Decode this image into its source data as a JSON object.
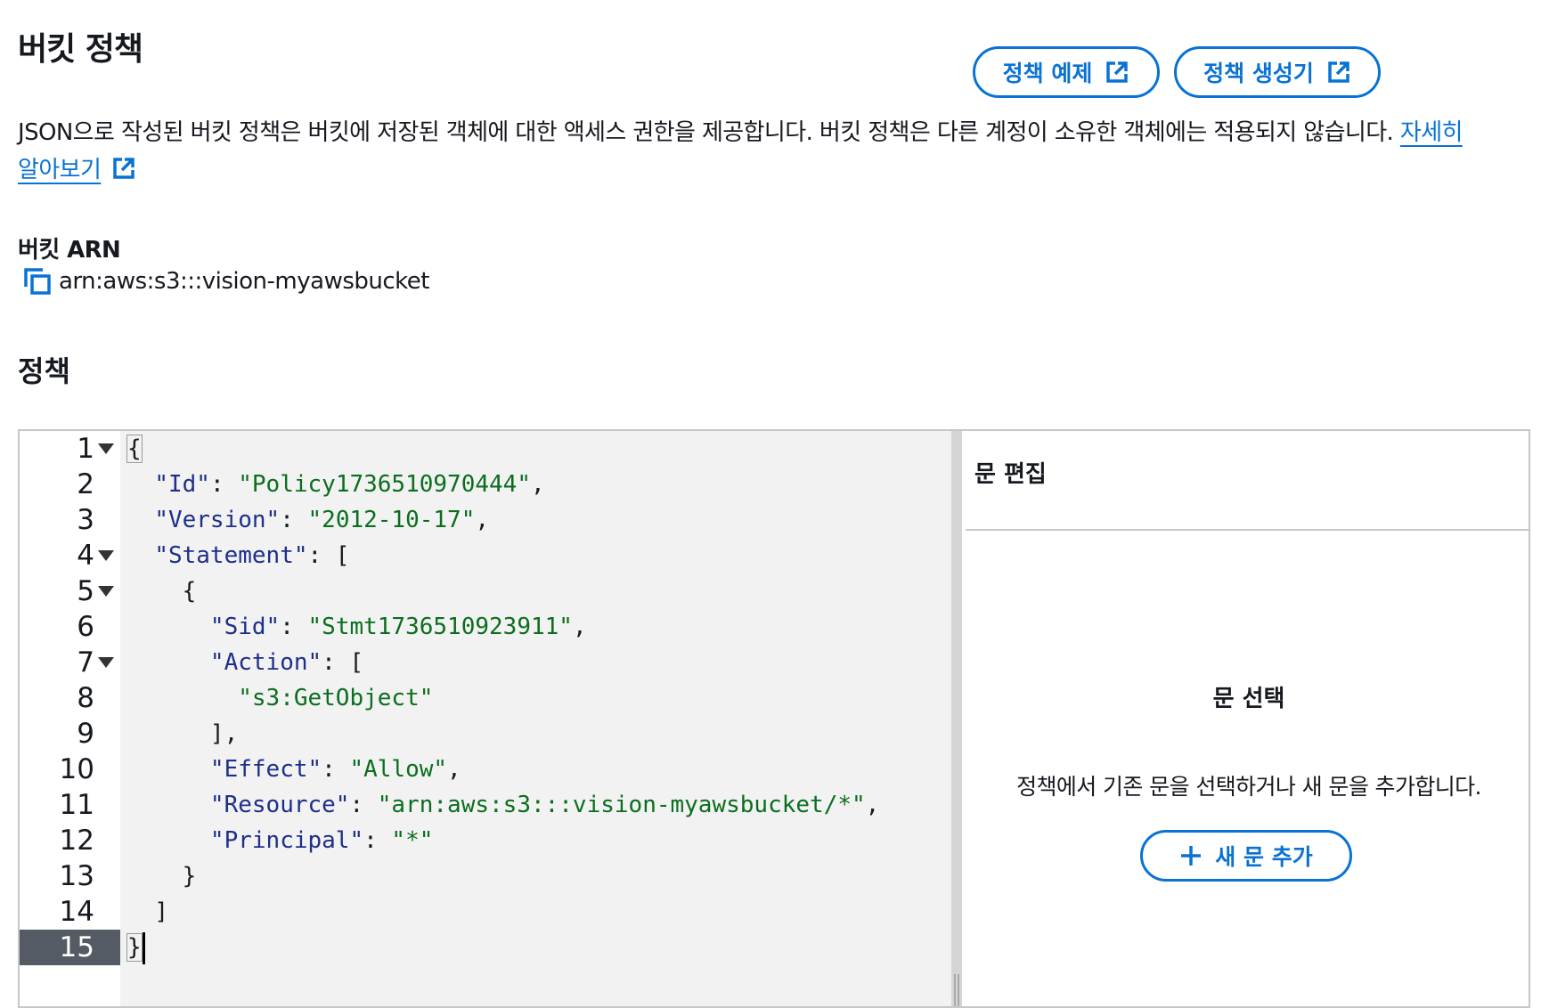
{
  "header": {
    "title": "버킷 정책",
    "policy_examples_label": "정책 예제",
    "policy_generator_label": "정책 생성기"
  },
  "description": {
    "text": "JSON으로 작성된 버킷 정책은 버킷에 저장된 객체에 대한 액세스 권한을 제공합니다. 버킷 정책은 다른 계정이 소유한 객체에는 적용되지 않습니다. ",
    "learn_more_part1": "자세히",
    "learn_more_part2": "알아보기"
  },
  "bucket_arn": {
    "label": "버킷 ARN",
    "value": "arn:aws:s3:::vision-myawsbucket"
  },
  "policy_section": {
    "title": "정책"
  },
  "editor": {
    "lines": [
      {
        "n": "1",
        "fold": true
      },
      {
        "n": "2",
        "fold": false
      },
      {
        "n": "3",
        "fold": false
      },
      {
        "n": "4",
        "fold": true
      },
      {
        "n": "5",
        "fold": true
      },
      {
        "n": "6",
        "fold": false
      },
      {
        "n": "7",
        "fold": true
      },
      {
        "n": "8",
        "fold": false
      },
      {
        "n": "9",
        "fold": false
      },
      {
        "n": "10",
        "fold": false
      },
      {
        "n": "11",
        "fold": false
      },
      {
        "n": "12",
        "fold": false
      },
      {
        "n": "13",
        "fold": false
      },
      {
        "n": "14",
        "fold": false
      },
      {
        "n": "15",
        "fold": false
      }
    ],
    "active_line": "15",
    "code": {
      "l1": "{",
      "id_key": "\"Id\"",
      "id_val": "\"Policy1736510970444\"",
      "version_key": "\"Version\"",
      "version_val": "\"2012-10-17\"",
      "statement_key": "\"Statement\"",
      "l5": "{",
      "sid_key": "\"Sid\"",
      "sid_val": "\"Stmt1736510923911\"",
      "action_key": "\"Action\"",
      "action_val": "\"s3:GetObject\"",
      "l9": "],",
      "effect_key": "\"Effect\"",
      "effect_val": "\"Allow\"",
      "resource_key": "\"Resource\"",
      "resource_val": "\"arn:aws:s3:::vision-myawsbucket/*\"",
      "principal_key": "\"Principal\"",
      "principal_val": "\"*\"",
      "l13": "}",
      "l14": "]",
      "l15": "}"
    }
  },
  "statement_panel": {
    "heading": "문 편집",
    "empty_title": "문 선택",
    "empty_text": "정책에서 기존 문을 선택하거나 새 문을 추가합니다.",
    "add_button_label": "새 문 추가"
  },
  "colors": {
    "accent": "#0972d3",
    "key": "#1e2f8a",
    "string": "#0b6e1e",
    "active_gutter": "#545b64"
  }
}
